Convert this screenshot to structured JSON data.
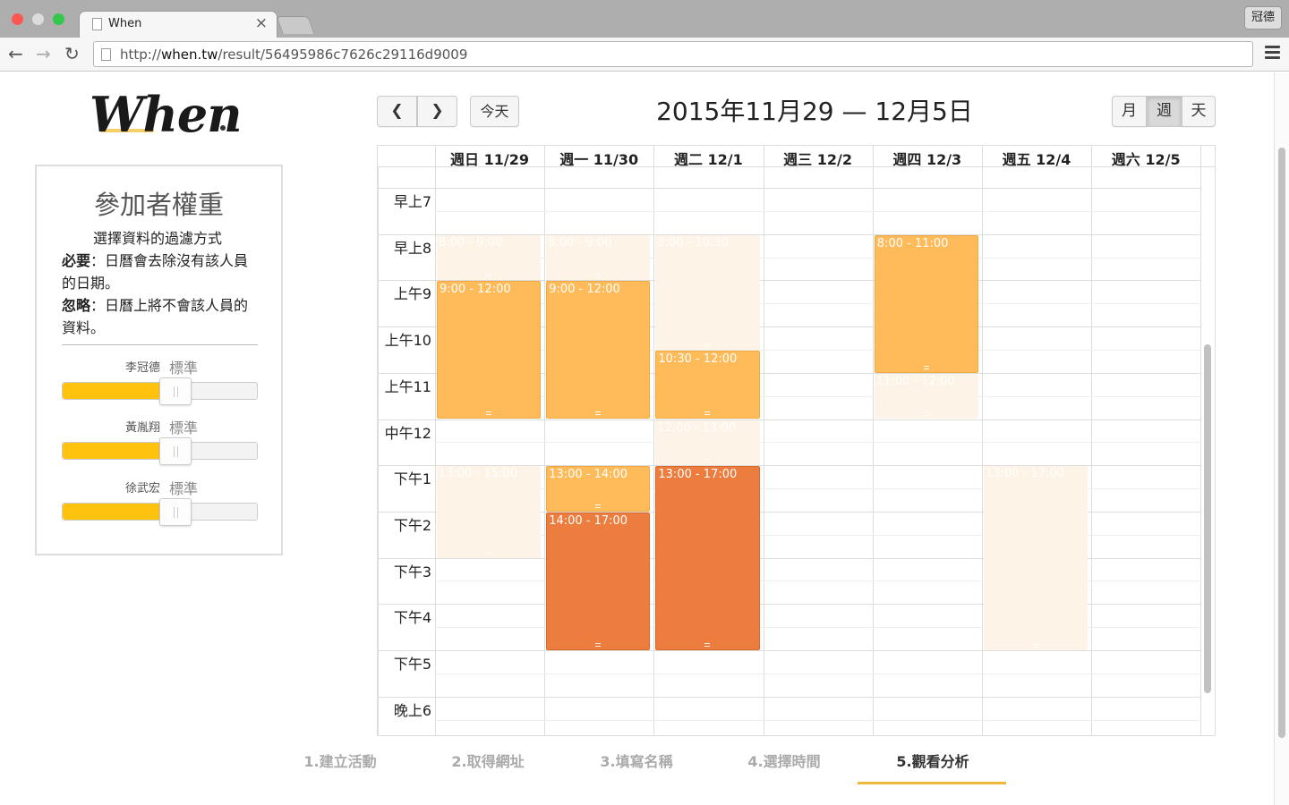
{
  "browser": {
    "tab_title": "When",
    "tab_close": "×",
    "url_prefix": "http://",
    "url_host": "when.tw",
    "url_path": "/result/56495986c7626c29116d9009",
    "profile_name": "冠德"
  },
  "logo": {
    "text": "When"
  },
  "panel": {
    "title": "參加者權重",
    "subtitle": "選擇資料的過濾方式",
    "required_label": "必要",
    "required_desc": "：日曆會去除沒有該人員的日期。",
    "ignore_label": "忽略",
    "ignore_desc": "：日曆上將不會該人員的資料。",
    "participants": [
      {
        "name": "李冠德",
        "weight": "標準",
        "level": 0.5
      },
      {
        "name": "黃胤翔",
        "weight": "標準",
        "level": 0.5
      },
      {
        "name": "徐武宏",
        "weight": "標準",
        "level": 0.5
      }
    ]
  },
  "toolbar": {
    "prev_icon": "chevron-left",
    "next_icon": "chevron-right",
    "today": "今天",
    "range_title": "2015年11月29 — 12月5日",
    "view_month": "月",
    "view_week": "週",
    "view_day": "天",
    "active_view": "週"
  },
  "calendar": {
    "days": [
      "週日 11/29",
      "週一 11/30",
      "週二 12/1",
      "週三 12/2",
      "週四 12/3",
      "週五 12/4",
      "週六 12/5"
    ],
    "time_labels": [
      {
        "hour": 7,
        "label": "早上7"
      },
      {
        "hour": 8,
        "label": "早上8"
      },
      {
        "hour": 9,
        "label": "上午9"
      },
      {
        "hour": 10,
        "label": "上午10"
      },
      {
        "hour": 11,
        "label": "上午11"
      },
      {
        "hour": 12,
        "label": "中午12"
      },
      {
        "hour": 13,
        "label": "下午1"
      },
      {
        "hour": 14,
        "label": "下午2"
      },
      {
        "hour": 15,
        "label": "下午3"
      },
      {
        "hour": 16,
        "label": "下午4"
      },
      {
        "hour": 17,
        "label": "下午5"
      },
      {
        "hour": 18,
        "label": "晚上6"
      }
    ],
    "events": [
      {
        "day": 0,
        "start": 8,
        "end": 9,
        "label": "8:00 - 9:00",
        "level": "light"
      },
      {
        "day": 0,
        "start": 9,
        "end": 12,
        "label": "9:00 - 12:00",
        "level": "mid"
      },
      {
        "day": 0,
        "start": 13,
        "end": 15,
        "label": "13:00 - 15:00",
        "level": "light"
      },
      {
        "day": 1,
        "start": 8,
        "end": 9,
        "label": "8:00 - 9:00",
        "level": "light"
      },
      {
        "day": 1,
        "start": 9,
        "end": 12,
        "label": "9:00 - 12:00",
        "level": "mid"
      },
      {
        "day": 1,
        "start": 13,
        "end": 14,
        "label": "13:00 - 14:00",
        "level": "mid"
      },
      {
        "day": 1,
        "start": 14,
        "end": 17,
        "label": "14:00 - 17:00",
        "level": "dark"
      },
      {
        "day": 2,
        "start": 8,
        "end": 10.5,
        "label": "8:00 - 10:30",
        "level": "light"
      },
      {
        "day": 2,
        "start": 10.5,
        "end": 12,
        "label": "10:30 - 12:00",
        "level": "mid"
      },
      {
        "day": 2,
        "start": 12,
        "end": 13,
        "label": "12:00 - 13:00",
        "level": "light"
      },
      {
        "day": 2,
        "start": 13,
        "end": 17,
        "label": "13:00 - 17:00",
        "level": "dark"
      },
      {
        "day": 4,
        "start": 8,
        "end": 11,
        "label": "8:00 - 11:00",
        "level": "mid"
      },
      {
        "day": 4,
        "start": 11,
        "end": 12,
        "label": "11:00 - 12:00",
        "level": "light"
      },
      {
        "day": 5,
        "start": 13,
        "end": 17,
        "label": "13:00 - 17:00",
        "level": "light"
      }
    ]
  },
  "steps": [
    {
      "label": "1.建立活動"
    },
    {
      "label": "2.取得網址"
    },
    {
      "label": "3.填寫名稱"
    },
    {
      "label": "4.選擇時間"
    },
    {
      "label": "5.觀看分析"
    }
  ],
  "active_step": 4,
  "colors": {
    "accent": "#ffc30f",
    "event_light": "#fdf3e6",
    "event_mid": "#ffbb5a",
    "event_dark": "#ed7d3e",
    "step_underline": "#f0b83a"
  }
}
